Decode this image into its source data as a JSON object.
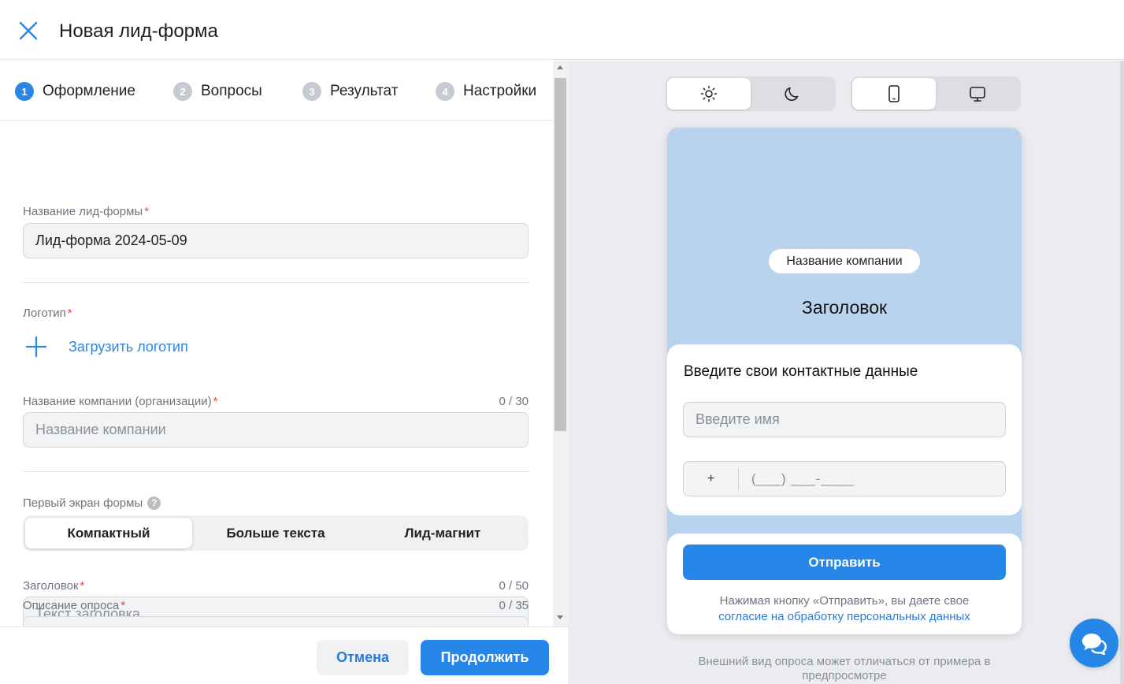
{
  "header": {
    "title": "Новая лид-форма"
  },
  "steps": [
    {
      "num": "1",
      "label": "Оформление",
      "active": true
    },
    {
      "num": "2",
      "label": "Вопросы"
    },
    {
      "num": "3",
      "label": "Результат"
    },
    {
      "num": "4",
      "label": "Настройки"
    }
  ],
  "form": {
    "form_name": {
      "label": "Название лид-формы",
      "required": "*",
      "value": "Лид-форма 2024-05-09"
    },
    "logo": {
      "label": "Логотип",
      "required": "*",
      "upload_label": "Загрузить логотип"
    },
    "company": {
      "label": "Название компании (организации)",
      "required": "*",
      "counter": "0 / 30",
      "placeholder": "Название компании"
    },
    "first_screen": {
      "label": "Первый экран формы",
      "help": "?",
      "options": [
        "Компактный",
        "Больше текста",
        "Лид-магнит"
      ],
      "selected": "Компактный"
    },
    "heading": {
      "label": "Заголовок",
      "required": "*",
      "counter": "0 / 50",
      "placeholder": "Текст заголовка"
    },
    "description": {
      "label": "Описание опроса",
      "required": "*",
      "counter": "0 / 35"
    }
  },
  "footer": {
    "cancel_label": "Отмена",
    "continue_label": "Продолжить"
  },
  "preview": {
    "theme_toggle": [
      "light-theme",
      "dark-theme"
    ],
    "device_toggle": [
      "mobile",
      "desktop"
    ],
    "company_chip": "Название компании",
    "title": "Заголовок",
    "card_title": "Введите свои контактные данные",
    "name_placeholder": "Введите имя",
    "phone_plus": "+",
    "phone_mask": "(___) ___-____",
    "submit_label": "Отправить",
    "consent_text": "Нажимая кнопку «Отправить», вы даете свое",
    "consent_link": "согласие на обработку персональных данных",
    "note": "Внешний вид опроса может отличаться от примера в предпросмотре"
  },
  "colors": {
    "accent": "#2787e8",
    "preview_bg": "#b9d3ee",
    "required": "#e64646"
  }
}
